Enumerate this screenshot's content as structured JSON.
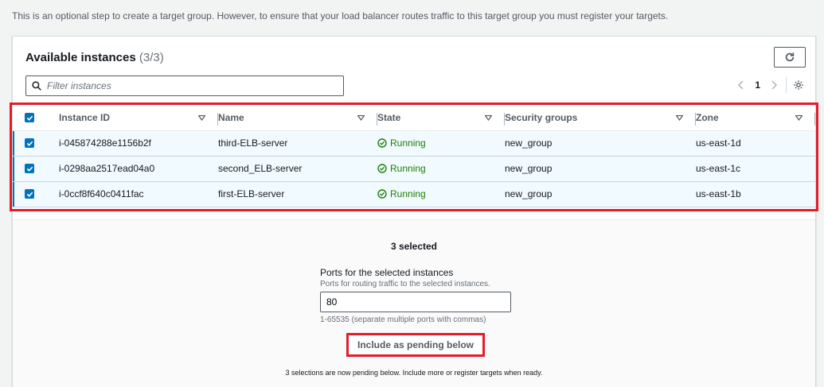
{
  "page": {
    "intro": "This is an optional step to create a target group. However, to ensure that your load balancer routes traffic to this target group you must register your targets."
  },
  "panel": {
    "title": "Available instances",
    "count": "(3/3)",
    "filter_placeholder": "Filter instances",
    "page_number": "1"
  },
  "table": {
    "columns": [
      "Instance ID",
      "Name",
      "State",
      "Security groups",
      "Zone"
    ],
    "rows": [
      {
        "instance_id": "i-045874288e1156b2f",
        "name": "third-ELB-server",
        "state": "Running",
        "security_group": "new_group",
        "zone": "us-east-1d"
      },
      {
        "instance_id": "i-0298aa2517ead04a0",
        "name": "second_ELB-server",
        "state": "Running",
        "security_group": "new_group",
        "zone": "us-east-1c"
      },
      {
        "instance_id": "i-0ccf8f640c0411fac",
        "name": "first-ELB-server",
        "state": "Running",
        "security_group": "new_group",
        "zone": "us-east-1b"
      }
    ]
  },
  "selection": {
    "count_label": "3 selected",
    "ports_label": "Ports for the selected instances",
    "ports_description": "Ports for routing traffic to the selected instances.",
    "ports_value": "80",
    "ports_hint": "1-65535 (separate multiple ports with commas)",
    "pending_button": "Include as pending below",
    "pending_note": "3 selections are now pending below. Include more or register targets when ready."
  },
  "colors": {
    "accent": "#0073bb",
    "running": "#1d8102",
    "highlight": "#e21c28"
  }
}
